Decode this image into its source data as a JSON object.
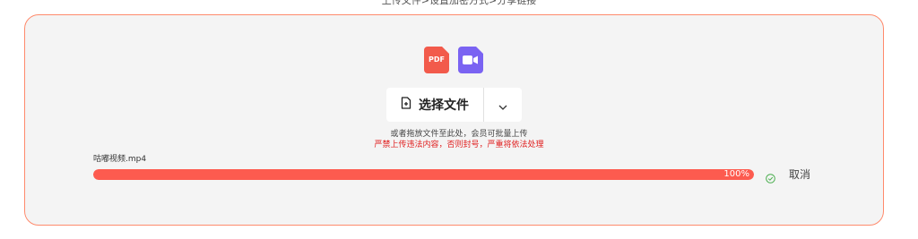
{
  "header": {
    "steps": "上传文件>设置加密方式>分享链接"
  },
  "upload": {
    "icons": [
      {
        "name": "pdf-file-icon",
        "label": "PDF",
        "color": "#f25a4b"
      },
      {
        "name": "video-file-icon",
        "color": "#7a63f2"
      }
    ],
    "select_label": "选择文件",
    "hint": "或者拖放文件至此处，会员可批量上传",
    "warning": "严禁上传违法内容，否则封号，严重将依法处理",
    "accent_color": "#fd5b4f",
    "warning_color": "#e02020"
  },
  "file": {
    "name": "咕嘟视频.mp4",
    "progress_label": "100%",
    "progress_fraction": 1.0,
    "status_icon": "check-circle-icon",
    "cancel_label": "取消"
  }
}
